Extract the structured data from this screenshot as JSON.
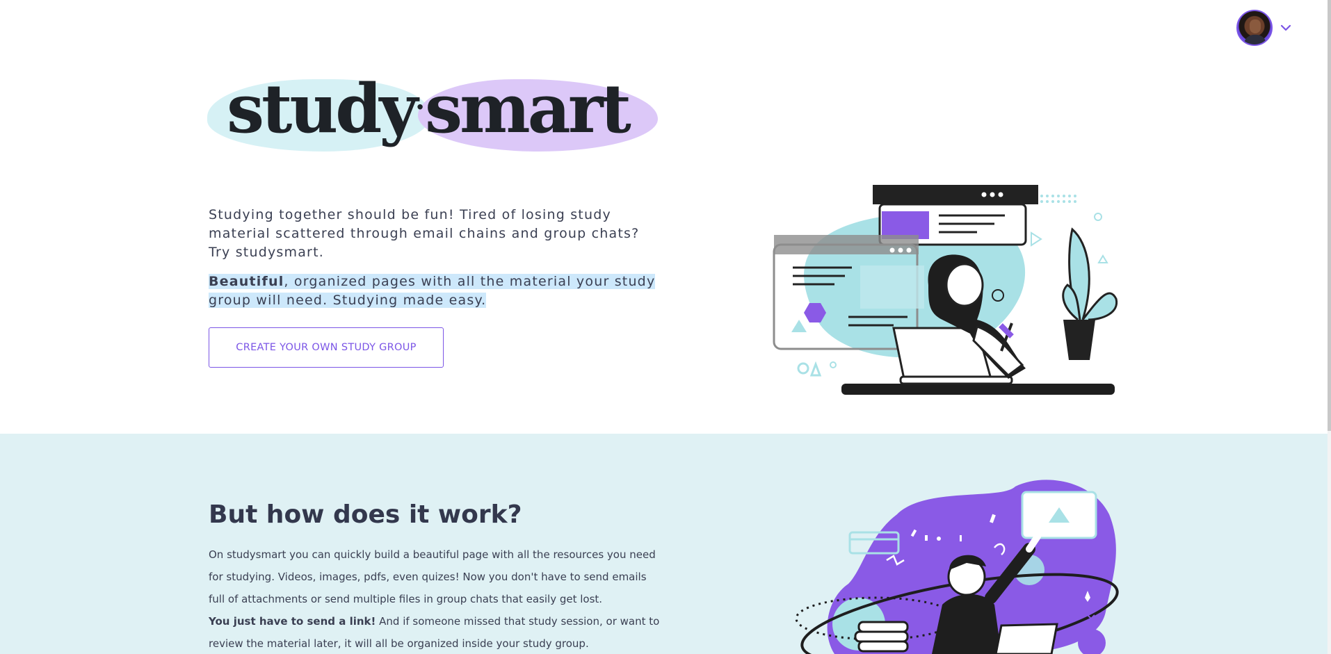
{
  "header": {
    "avatar_alt": "User avatar",
    "menu_icon": "chevron-down-icon"
  },
  "logo": {
    "word1": "study",
    "separator": "·",
    "word2": "smart"
  },
  "hero": {
    "paragraph1": "Studying together should be fun! Tired of losing study material scattered through email chains and group chats? Try studysmart.",
    "paragraph2_bold": "Beautiful",
    "paragraph2_rest": ", organized pages with all the material your study group will need. Studying made easy. ",
    "cta_label": "CREATE YOUR OWN STUDY GROUP"
  },
  "how": {
    "title": "But how does it work?",
    "paragraph1": "On studysmart you can quickly build a beautiful page with all the resources you need for studying. Videos, images, pdfs, even quizes! Now you don't have to send emails full of attachments or send multiple files in group chats that easily get lost.",
    "paragraph2_bold": "You just have to send a link!",
    "paragraph2_rest": " And if someone missed that study session, or want to review the material later, it will all be organized inside your study group."
  },
  "colors": {
    "accent": "#7b55e6",
    "teal_light": "#dff1f4",
    "lavender": "#dcc8f8",
    "mint": "#d6f1f5"
  }
}
